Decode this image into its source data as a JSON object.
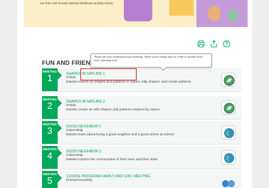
{
  "banner": {
    "text": "our free Girl Scouts Mental Wellness activity sheet."
  },
  "toolbar": {
    "print_icon": "print-icon",
    "share_icon": "share-icon",
    "help_icon": "help-icon"
  },
  "section": {
    "title": "FUN AND FRIENDS"
  },
  "tooltip": {
    "text": "These are your individual troop meetings. When you're ready click on a title to access even more planning tools."
  },
  "meetings": [
    {
      "label": "MEETING",
      "number": "1",
      "title": "SHAPES IN NATURE 1",
      "subtitle": "STEM",
      "description": "Daisies search for shapes and patterns in nature, tally shapes, and create patterns.",
      "icon": "leaf-badge-icon"
    },
    {
      "label": "MEETING",
      "number": "2",
      "title": "SHAPES IN NATURE 2",
      "subtitle": "STEM",
      "description": "Daisies create art with shapes and patterns inspired by nature.",
      "icon": "leaf-badge-icon"
    },
    {
      "label": "MEETING",
      "number": "3",
      "title": "GOOD NEIGHBOR 1",
      "subtitle": "Citizenship",
      "description": "Daisies learn about being a good neighbor and a good citizen at school.",
      "icon": "globe-badge-icon"
    },
    {
      "label": "MEETING",
      "number": "4",
      "title": "GOOD NEIGHBOR 2",
      "subtitle": "Citizenship",
      "description": "Daisies explore the communities of their town and their state.",
      "icon": "globe-badge-icon"
    },
    {
      "label": "MEETING",
      "number": "5",
      "title": "COOKIE PROGRAM FAMILY AND GIRL MEETING",
      "subtitle": "Entrepreneurship",
      "description": "",
      "icon": "cookie-badge-icon"
    }
  ],
  "colors": {
    "accent": "#00a85a",
    "highlight": "#d9262a"
  }
}
